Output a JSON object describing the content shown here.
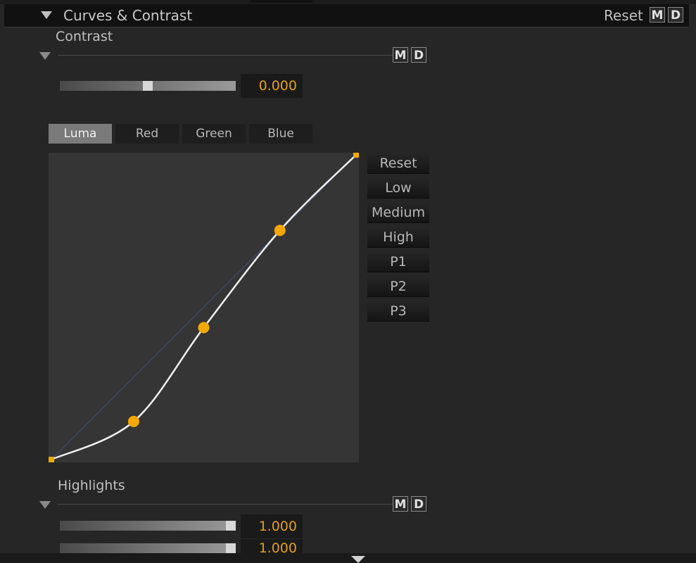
{
  "section": {
    "title": "Curves & Contrast",
    "reset_label": "Reset",
    "m_label": "M",
    "d_label": "D"
  },
  "contrast": {
    "label": "Contrast",
    "m_label": "M",
    "d_label": "D",
    "value": "0.000",
    "slider_level": 0.5
  },
  "channels": {
    "tabs": [
      {
        "label": "Luma",
        "active": true
      },
      {
        "label": "Red",
        "active": false
      },
      {
        "label": "Green",
        "active": false
      },
      {
        "label": "Blue",
        "active": false
      }
    ]
  },
  "curve": {
    "points": [
      [
        0,
        0
      ],
      [
        0.27,
        0.125
      ],
      [
        0.5,
        0.433
      ],
      [
        0.75,
        0.752
      ],
      [
        1,
        1
      ]
    ],
    "point_color": "#f5a800",
    "curve_color": "#f0f0f0",
    "diagonal_color": "#3a4f80"
  },
  "presets": {
    "buttons": [
      "Reset",
      "Low",
      "Medium",
      "High",
      "P1",
      "P2",
      "P3"
    ]
  },
  "highlights": {
    "label": "Highlights",
    "m_label": "M",
    "d_label": "D",
    "values": [
      "1.000",
      "1.000"
    ],
    "slider_levels": [
      1.0,
      1.0
    ]
  },
  "colors": {
    "accent": "#e0a020"
  }
}
